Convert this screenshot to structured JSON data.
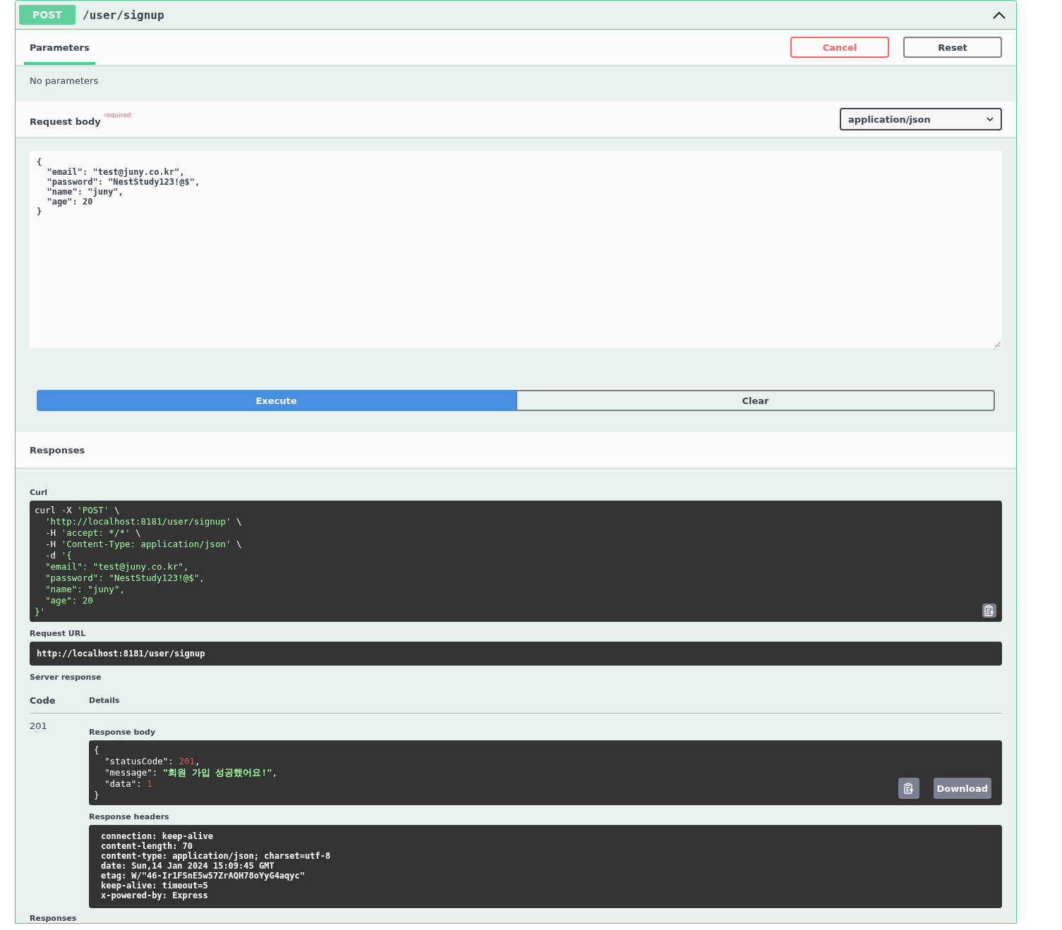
{
  "operation": {
    "method": "POST",
    "path": "/user/signup",
    "expanded": true
  },
  "tabs": [
    {
      "label": "Parameters",
      "selected": true
    }
  ],
  "actions": [
    {
      "label": "Cancel",
      "kind": "cancel"
    },
    {
      "label": "Reset",
      "kind": "reset"
    }
  ],
  "parameters_note": "No parameters",
  "request_body": {
    "title": "Request body",
    "required_mark": "required",
    "content_type": "application/json",
    "value": "{\n  \"email\": \"test@juny.co.kr\",\n  \"password\": \"NestStudy123!@$\",\n  \"name\": \"juny\",\n  \"age\": 20\n}"
  },
  "buttons": [
    {
      "label": "Execute",
      "kind": "primary"
    },
    {
      "label": "Clear",
      "kind": "secondary"
    }
  ],
  "responses_title": "Responses",
  "curl": {
    "label": "Curl",
    "lines": [
      [
        {
          "t": "curl -X ",
          "kind": "plain"
        },
        {
          "t": "'POST'",
          "kind": "string"
        },
        {
          "t": " \\",
          "kind": "plain"
        }
      ],
      [
        {
          "t": "  'http://localhost:8181/user/signup'",
          "kind": "string"
        },
        {
          "t": " \\",
          "kind": "plain"
        }
      ],
      [
        {
          "t": "  -H ",
          "kind": "plain"
        },
        {
          "t": "'accept: */*'",
          "kind": "string"
        },
        {
          "t": " \\",
          "kind": "plain"
        }
      ],
      [
        {
          "t": "  -H ",
          "kind": "plain"
        },
        {
          "t": "'Content-Type: application/json'",
          "kind": "string"
        },
        {
          "t": " \\",
          "kind": "plain"
        }
      ],
      [
        {
          "t": "  -d ",
          "kind": "plain"
        },
        {
          "t": "'{",
          "kind": "string"
        }
      ],
      [
        {
          "t": "  \"email\": \"test@juny.co.kr\",",
          "kind": "string"
        }
      ],
      [
        {
          "t": "  \"password\": \"NestStudy123!@$\",",
          "kind": "string"
        }
      ],
      [
        {
          "t": "  \"name\": \"juny\",",
          "kind": "string"
        }
      ],
      [
        {
          "t": "  \"age\": 20",
          "kind": "string"
        }
      ],
      [
        {
          "t": "}'",
          "kind": "string"
        }
      ]
    ]
  },
  "request_url": {
    "label": "Request URL",
    "value": "http://localhost:8181/user/signup"
  },
  "server_response": {
    "label": "Server response",
    "columns": [
      "Code",
      "Details"
    ],
    "code": "201",
    "response_body": {
      "label": "Response body",
      "download": "Download",
      "lines": [
        [
          {
            "t": "{",
            "kind": "plain"
          }
        ],
        [
          {
            "t": "  \"statusCode\": ",
            "kind": "plain"
          },
          {
            "t": "201",
            "kind": "number"
          },
          {
            "t": ",",
            "kind": "plain"
          }
        ],
        [
          {
            "t": "  \"message\": ",
            "kind": "plain"
          },
          {
            "t": "\"회원 가입 성공했어요!\"",
            "kind": "string"
          },
          {
            "t": ",",
            "kind": "plain"
          }
        ],
        [
          {
            "t": "  \"data\": ",
            "kind": "plain"
          },
          {
            "t": "1",
            "kind": "number"
          }
        ],
        [
          {
            "t": "}",
            "kind": "plain"
          }
        ]
      ]
    },
    "response_headers": {
      "label": "Response headers",
      "lines": [
        "connection: keep-alive",
        "content-length: 70",
        "content-type: application/json; charset=utf-8",
        "date: Sun,14 Jan 2024 15:09:45 GMT",
        "etag: W/\"46-Ir1FSnE5w57ZrAQH78oYyG4aqyc\"",
        "keep-alive: timeout=5",
        "x-powered-by: Express"
      ]
    }
  },
  "footer_title": "Responses"
}
